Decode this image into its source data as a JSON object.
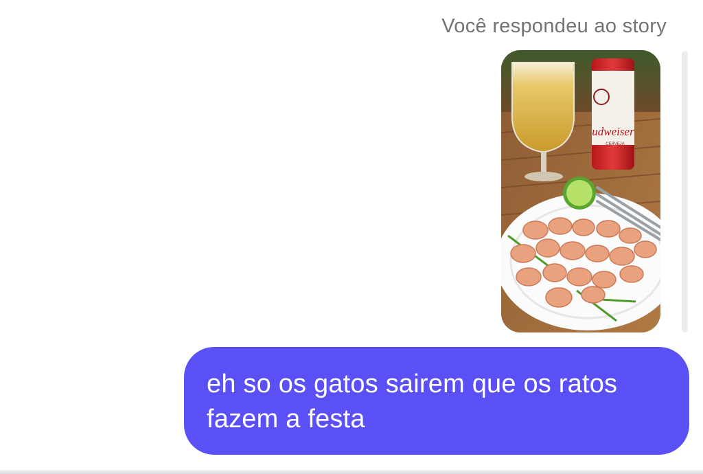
{
  "thread": {
    "reply_context_label": "Você respondeu ao story",
    "story_preview": {
      "icon": "story-photo",
      "can_label": "udweiser",
      "can_sublabel": "CERVEJA"
    },
    "message": {
      "text": "eh so os gatos sairem que os ratos fazem a festa"
    }
  },
  "colors": {
    "bubble": "#5b50f5",
    "meta_text": "#737373"
  }
}
